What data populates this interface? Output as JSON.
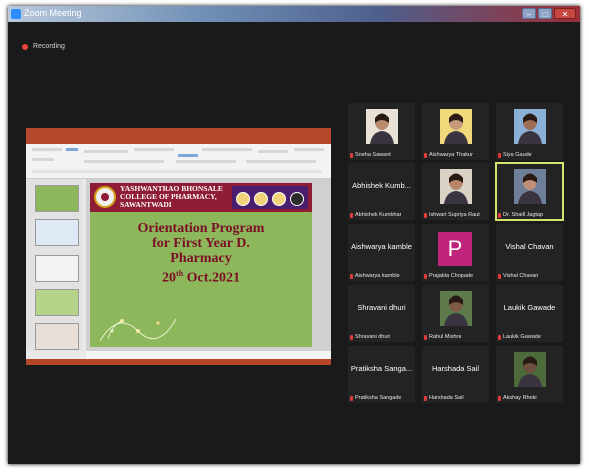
{
  "window": {
    "title": "Zoom Meeting",
    "buttons": [
      "–",
      "□",
      "✕"
    ]
  },
  "recording": {
    "label": "Recording"
  },
  "shared_screen": {
    "slide": {
      "college_name": "YASHWANTRAO BHONSALE COLLEGE OF PHARMACY, SAWANTWADI",
      "heading_line1": "Orientation Program",
      "heading_line2": "for First Year D.",
      "heading_line3": "Pharmacy",
      "date_day": "20",
      "date_suffix": "th",
      "date_rest": " Oct.2021"
    }
  },
  "participants": [
    {
      "label": "Sneha Sawant",
      "display": "video",
      "skin": "#b98a6c",
      "bg": "#e7e1d6"
    },
    {
      "label": "Aishwarya Thakur",
      "display": "video",
      "skin": "#c69a7a",
      "bg": "#f0d97a"
    },
    {
      "label": "Siya Gaude",
      "display": "video",
      "skin": "#9f6f55",
      "bg": "#8bb0d8"
    },
    {
      "label": "Abhishek Kumbhar",
      "name": "Abhishek Kumb...",
      "display": "name"
    },
    {
      "label": "Ishwari Supriya Raut",
      "display": "video",
      "skin": "#b7866a",
      "bg": "#d9d2c5"
    },
    {
      "label": "Dr. Shaill Jagtap",
      "display": "video",
      "skin": "#c09178",
      "bg": "#6d7f99",
      "active": true
    },
    {
      "label": "Aishwarya kamble",
      "name": "Aishwarya kamble",
      "display": "name"
    },
    {
      "label": "Prajakta Chopade",
      "display": "avatar",
      "initial": "P"
    },
    {
      "label": "Vishal Chavan",
      "name": "Vishal Chavan",
      "display": "name"
    },
    {
      "label": "Shravani dhuri",
      "name": "Shravani dhuri",
      "display": "name"
    },
    {
      "label": "Rahul Mishra",
      "display": "video",
      "skin": "#7e5a45",
      "bg": "#5f7a4a"
    },
    {
      "label": "Laukik Gawade",
      "name": "Laukik Gawade",
      "display": "name"
    },
    {
      "label": "Pratiksha Sangade",
      "name": "Pratiksha Sanga...",
      "display": "name"
    },
    {
      "label": "Harshada Sail",
      "name": "Harshada Sail",
      "display": "name"
    },
    {
      "label": "Akshay Rheki",
      "display": "video",
      "skin": "#6e4e3c",
      "bg": "#4d6a3a"
    }
  ]
}
